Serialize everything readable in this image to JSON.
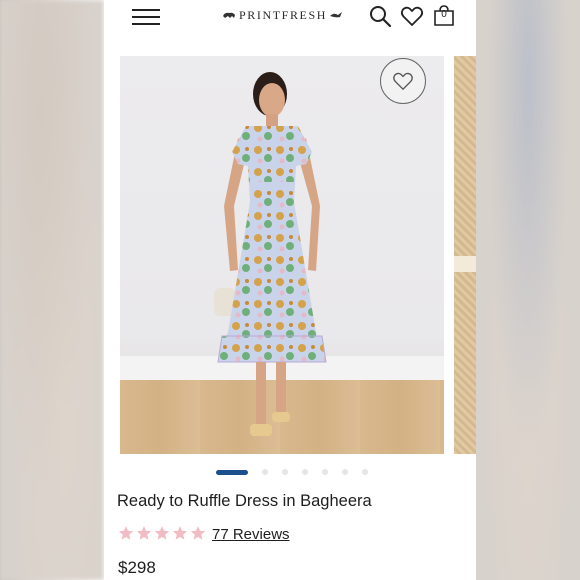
{
  "header": {
    "brand": "PRINTFRESH",
    "bag_count": "0"
  },
  "product": {
    "title": "Ready to Ruffle Dress in Bagheera",
    "rating": 5,
    "reviews": "77 Reviews",
    "price": "$298",
    "image_count": 8,
    "active_image": 1
  },
  "colors": {
    "accent": "#1d4f8f",
    "star": "#f2bcc4",
    "text": "#1e1e1e"
  },
  "icons": [
    "menu-icon",
    "search-icon",
    "heart-icon",
    "bag-icon",
    "star-icon"
  ]
}
